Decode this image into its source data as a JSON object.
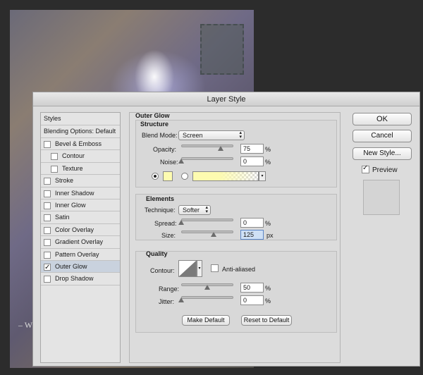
{
  "dialog": {
    "title": "Layer Style"
  },
  "styles_list": {
    "header": "Styles",
    "blending": "Blending Options: Default",
    "items": [
      {
        "label": "Bevel & Emboss",
        "checked": false
      },
      {
        "label": "Contour",
        "checked": false,
        "indent": true
      },
      {
        "label": "Texture",
        "checked": false,
        "indent": true
      },
      {
        "label": "Stroke",
        "checked": false
      },
      {
        "label": "Inner Shadow",
        "checked": false
      },
      {
        "label": "Inner Glow",
        "checked": false
      },
      {
        "label": "Satin",
        "checked": false
      },
      {
        "label": "Color Overlay",
        "checked": false
      },
      {
        "label": "Gradient Overlay",
        "checked": false
      },
      {
        "label": "Pattern Overlay",
        "checked": false
      },
      {
        "label": "Outer Glow",
        "checked": true,
        "selected": true
      },
      {
        "label": "Drop Shadow",
        "checked": false
      }
    ]
  },
  "panel": {
    "title": "Outer Glow",
    "structure": {
      "title": "Structure",
      "blend_mode_label": "Blend Mode:",
      "blend_mode_value": "Screen",
      "opacity_label": "Opacity:",
      "opacity_value": "75",
      "opacity_level": 0.75,
      "noise_label": "Noise:",
      "noise_value": "0",
      "noise_level": 0.0,
      "percent": "%",
      "glow_color": "#fdfbb0"
    },
    "elements": {
      "title": "Elements",
      "technique_label": "Technique:",
      "technique_value": "Softer",
      "spread_label": "Spread:",
      "spread_value": "0",
      "spread_level": 0.0,
      "size_label": "Size:",
      "size_value": "125",
      "size_unit": "px",
      "percent": "%"
    },
    "quality": {
      "title": "Quality",
      "contour_label": "Contour:",
      "anti_aliased_label": "Anti-aliased",
      "anti_aliased_checked": false,
      "range_label": "Range:",
      "range_value": "50",
      "range_level": 0.5,
      "jitter_label": "Jitter:",
      "jitter_value": "0",
      "jitter_level": 0.0,
      "percent": "%"
    },
    "make_default_label": "Make Default",
    "reset_default_label": "Reset to Default"
  },
  "buttons": {
    "ok": "OK",
    "cancel": "Cancel",
    "new_style": "New Style...",
    "preview_label": "Preview",
    "preview_checked": true
  }
}
